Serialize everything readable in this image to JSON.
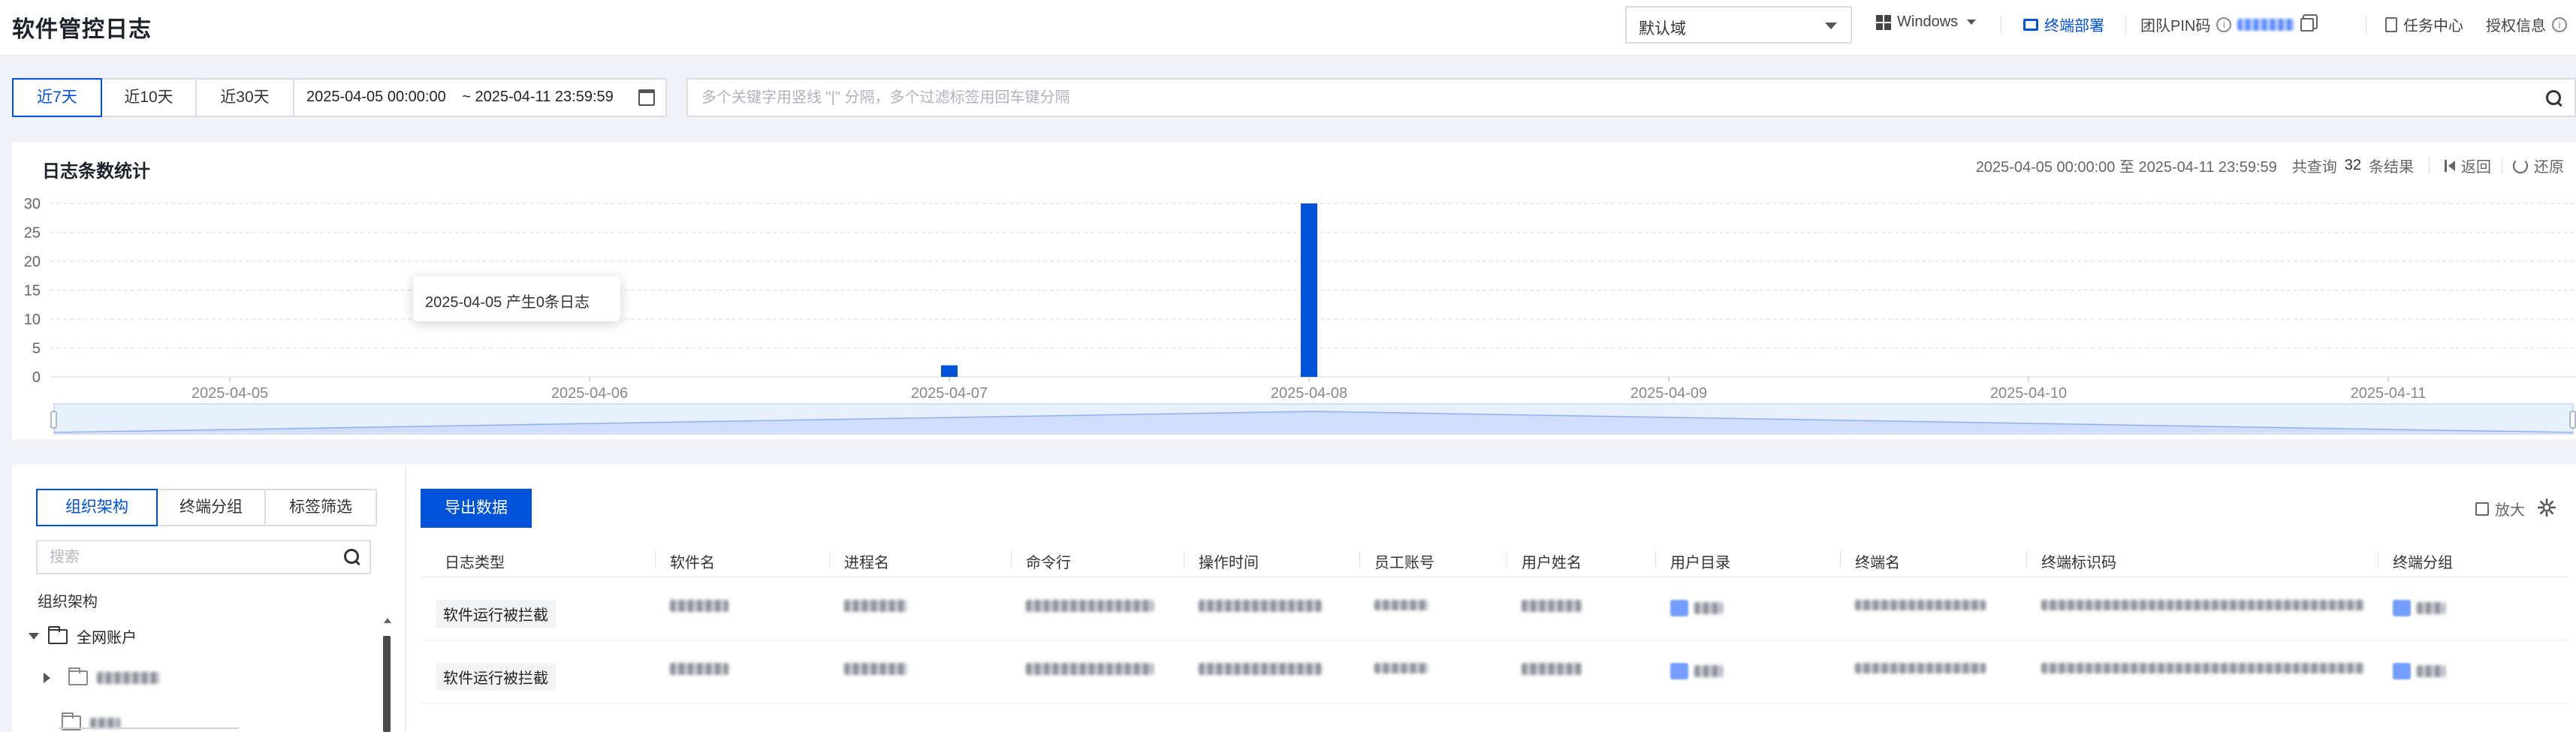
{
  "header": {
    "title": "软件管控日志",
    "domain_select": "默认域",
    "os_select": "Windows",
    "deploy_link": "终端部署",
    "team_pin_label": "团队PIN码",
    "task_center": "任务中心",
    "license_info": "授权信息"
  },
  "filters": {
    "ranges": [
      "近7天",
      "近10天",
      "近30天"
    ],
    "active_range": "近7天",
    "date_start": "2025-04-05 00:00:00",
    "date_end": "~ 2025-04-11 23:59:59",
    "search_placeholder": "多个关键字用竖线 \"|\" 分隔，多个过滤标签用回车键分隔"
  },
  "chart_panel": {
    "title": "日志条数统计",
    "range_text": "2025-04-05 00:00:00 至 2025-04-11 23:59:59",
    "result_prefix": "共查询",
    "result_count": "32",
    "result_suffix": "条结果",
    "back_label": "返回",
    "restore_label": "还原",
    "tooltip": "2025-04-05 产生0条日志"
  },
  "chart_data": {
    "type": "bar",
    "categories": [
      "2025-04-05",
      "2025-04-06",
      "2025-04-07",
      "2025-04-08",
      "2025-04-09",
      "2025-04-10",
      "2025-04-11"
    ],
    "values": [
      0,
      0,
      2,
      30,
      0,
      0,
      0
    ],
    "ylim": [
      0,
      30
    ],
    "yticks": [
      "0",
      "5",
      "10",
      "15",
      "20",
      "25",
      "30"
    ],
    "grid": true,
    "bar_color": "#0052d9"
  },
  "left_panel": {
    "tabs": [
      "组织架构",
      "终端分组",
      "标签筛选"
    ],
    "active_tab": "组织架构",
    "search_placeholder": "搜索",
    "tree_label": "组织架构",
    "root_node": "全网账户"
  },
  "table": {
    "export_label": "导出数据",
    "zoom_label": "放大",
    "columns": [
      "日志类型",
      "软件名",
      "进程名",
      "命令行",
      "操作时间",
      "员工账号",
      "用户姓名",
      "用户目录",
      "终端名",
      "终端标识码",
      "终端分组"
    ],
    "rows": [
      {
        "log_type": "软件运行被拦截"
      },
      {
        "log_type": "软件运行被拦截"
      }
    ]
  },
  "colors": {
    "accent": "#0052d9",
    "page_bg": "#f2f3f8",
    "grid": "#e5e6eb"
  },
  "icons": [
    "windows-icon",
    "monitor-icon",
    "info-icon",
    "copy-icon",
    "document-icon",
    "calendar-icon",
    "search-icon",
    "back-icon",
    "restore-icon",
    "folder-icon",
    "zoom-icon",
    "gear-icon"
  ]
}
